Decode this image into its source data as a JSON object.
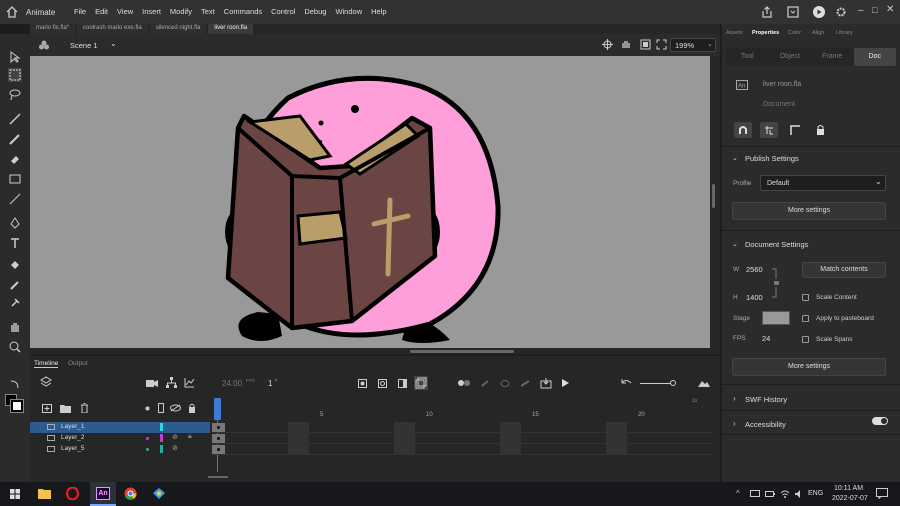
{
  "app": {
    "name": "Animate"
  },
  "menu": [
    "File",
    "Edit",
    "View",
    "Insert",
    "Modify",
    "Text",
    "Commands",
    "Control",
    "Debug",
    "Window",
    "Help"
  ],
  "tabs": [
    "mario fix.fla*",
    "coolrash mario exe.fla",
    "silenced night.fla",
    "liver roon.fla"
  ],
  "scene": {
    "label": "Scene 1",
    "zoom": "199%"
  },
  "timeline": {
    "tab_timeline": "Timeline",
    "tab_output": "Output",
    "fps": "24.00",
    "fps_unit": "FPS",
    "frame": "1",
    "frame_unit": "F",
    "frame_numbers": [
      "5",
      "10",
      "15",
      "20"
    ],
    "end_marker": "1s",
    "layers": [
      {
        "name": "Layer_1",
        "color": "#28d8e0"
      },
      {
        "name": "Layer_2",
        "color": "#c040d0"
      },
      {
        "name": "Layer_5",
        "color": "#20b0a0"
      }
    ]
  },
  "right_panel": {
    "tabs": [
      "Assets",
      "Properties",
      "Color",
      "Align",
      "Library"
    ],
    "subtabs": [
      "Tool",
      "Object",
      "Frame",
      "Doc"
    ],
    "doc_name": "liver roon.fla",
    "doc_type": "Document",
    "publish": {
      "title": "Publish Settings",
      "profile_label": "Profile",
      "profile_value": "Default",
      "more": "More settings"
    },
    "docsettings": {
      "title": "Document Settings",
      "w_label": "W",
      "w_value": "2560",
      "h_label": "H",
      "h_value": "1400",
      "match": "Match contents",
      "scale_content": "Scale Content",
      "apply_pasteboard": "Apply to pasteboard",
      "stage_label": "Stage",
      "fps_label": "FPS",
      "fps_value": "24",
      "scale_spans": "Scale Spans",
      "more": "More settings"
    },
    "swf_history": "SWF History",
    "accessibility": "Accessibility"
  },
  "taskbar": {
    "time": "10:11 AM",
    "date": "2022-07-07",
    "lang": "ENG"
  },
  "colors": {
    "accent": "#3a7bd5",
    "stage": "#999999",
    "pink": "#ff9fd9",
    "book": "#6b4543",
    "gold": "#b99e6b"
  }
}
